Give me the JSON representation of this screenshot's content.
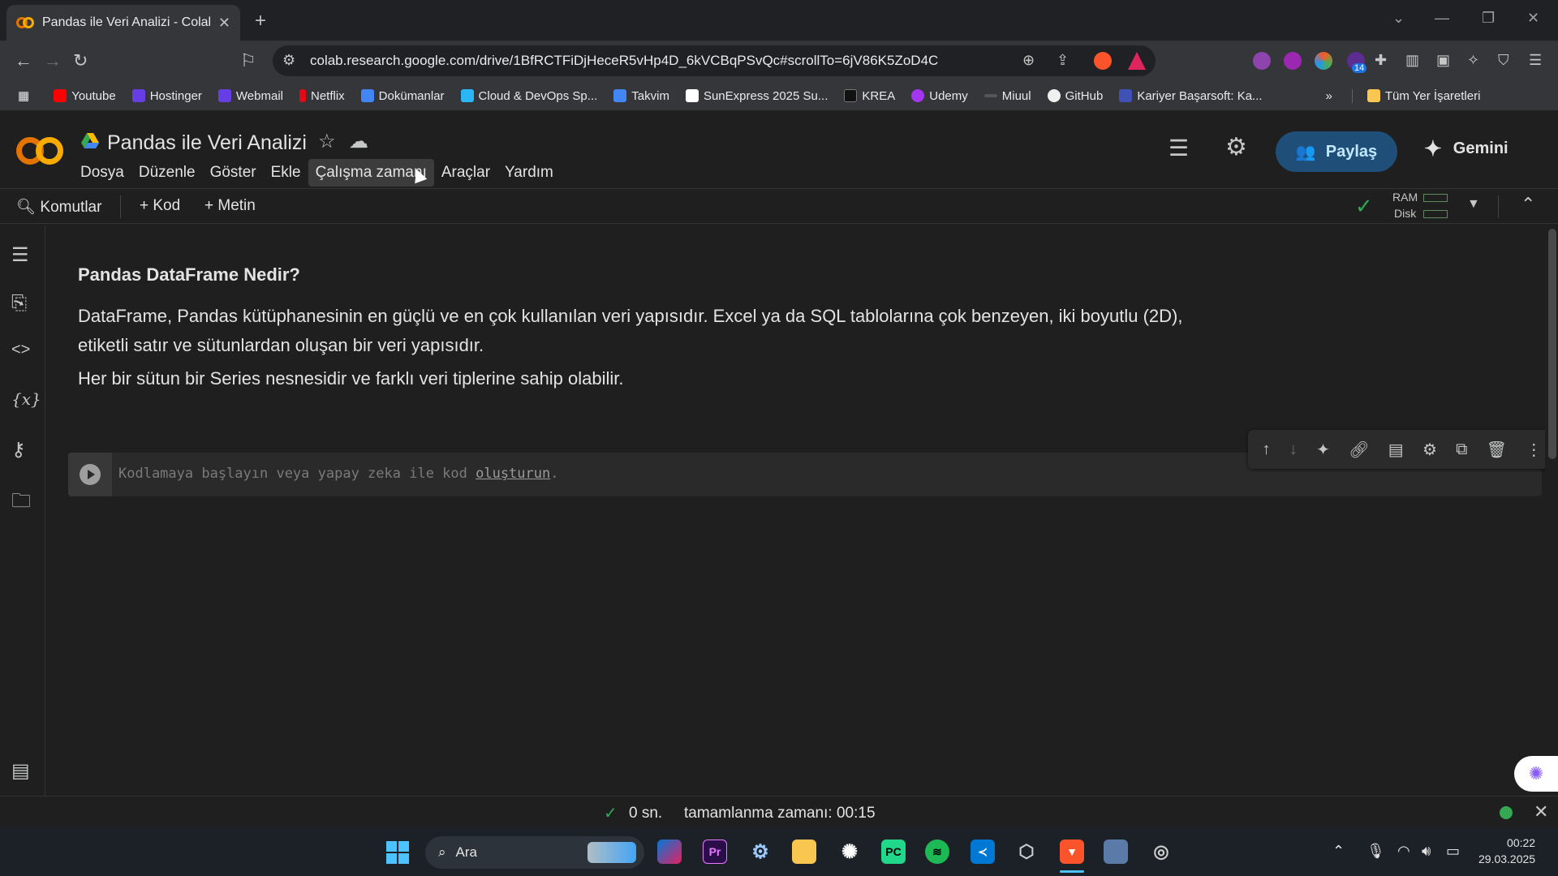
{
  "browser": {
    "tab_title": "Pandas ile Veri Analizi - Colab",
    "url": "colab.research.google.com/drive/1BfRCTFiDjHeceR5vHp4D_6kVCBqPSvQc#scrollTo=6jV86K5ZoD4C",
    "ext_badge": "14",
    "bookmarks": [
      {
        "label": "Youtube",
        "color": "#ff0000"
      },
      {
        "label": "Hostinger",
        "color": "#673de6"
      },
      {
        "label": "Webmail",
        "color": "#673de6"
      },
      {
        "label": "Netflix",
        "color": "#e50914"
      },
      {
        "label": "Dokümanlar",
        "color": "#4285f4"
      },
      {
        "label": "Cloud & DevOps Sp...",
        "color": "#29b6f6"
      },
      {
        "label": "Takvim",
        "color": "#4285f4"
      },
      {
        "label": "SunExpress 2025 Su...",
        "color": "#ffffff"
      },
      {
        "label": "KREA",
        "color": "#111111"
      },
      {
        "label": "Udemy",
        "color": "#a435f0"
      },
      {
        "label": "Miuul",
        "color": "#555555"
      },
      {
        "label": "GitHub",
        "color": "#f0f0f0"
      },
      {
        "label": "Kariyer Başarsoft: Ka...",
        "color": "#3f51b5"
      }
    ],
    "all_bookmarks": "Tüm Yer İşaretleri"
  },
  "colab": {
    "notebook_title": "Pandas ile Veri Analizi",
    "menu": [
      "Dosya",
      "Düzenle",
      "Göster",
      "Ekle",
      "Çalışma zamanı",
      "Araçlar",
      "Yardım"
    ],
    "share_label": "Paylaş",
    "gemini_label": "Gemini",
    "toolbar": {
      "commands": "Komutlar",
      "add_code": "Kod",
      "add_text": "Metin",
      "ram": "RAM",
      "disk": "Disk"
    }
  },
  "cells": {
    "heading": "Pandas DataFrame Nedir?",
    "paragraph1": "DataFrame, Pandas kütüphanesinin en güçlü ve en çok kullanılan veri yapısıdır. Excel ya da SQL tablolarına çok benzeyen, iki boyutlu (2D), etiketli satır ve sütunlardan oluşan bir veri yapısıdır.",
    "paragraph2": "Her bir sütun bir Series nesnesidir ve farklı veri tiplerine sahip olabilir.",
    "code_placeholder_prefix": "Kodlamaya başlayın veya yapay zeka ile kod ",
    "code_placeholder_link": "oluşturun",
    "code_placeholder_suffix": "."
  },
  "status": {
    "duration": "0 sn.",
    "completed": "tamamlanma zamanı: 00:15"
  },
  "taskbar": {
    "search": "Ara",
    "time": "00:22",
    "date": "29.03.2025"
  }
}
